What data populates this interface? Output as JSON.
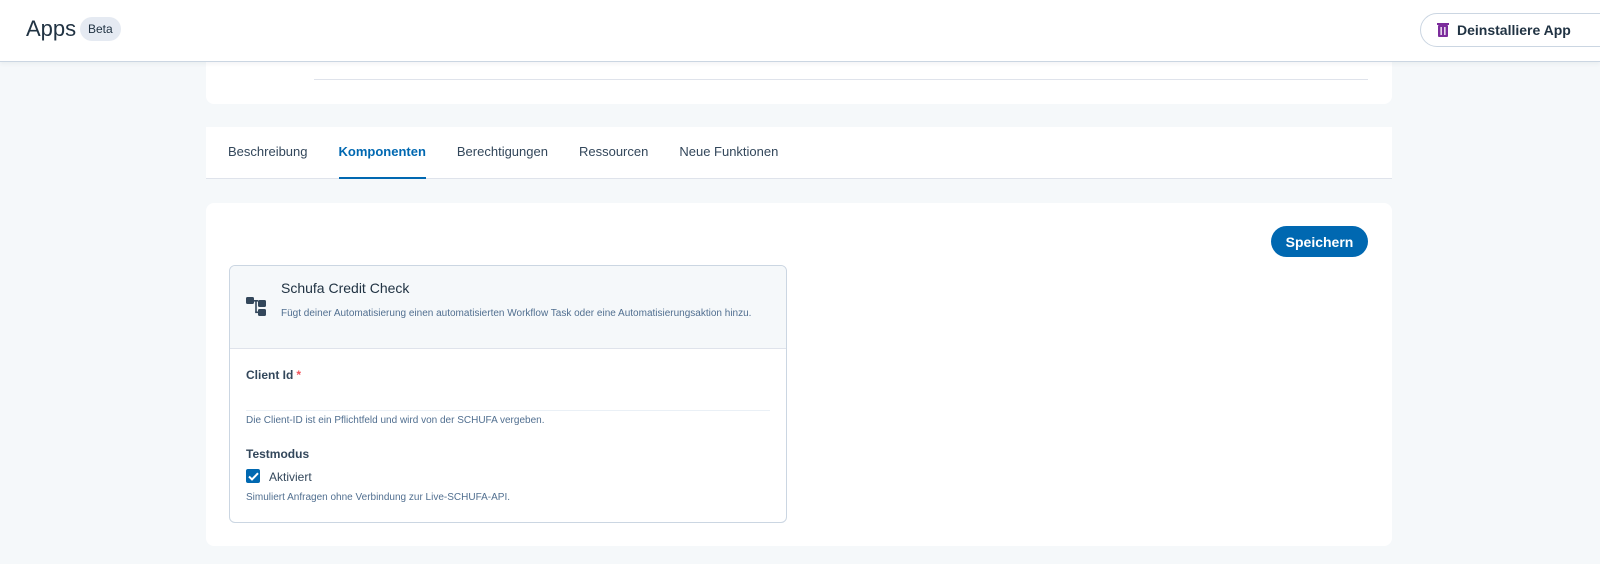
{
  "header": {
    "title": "Apps",
    "badge": "Beta",
    "uninstall_label": "Deinstalliere App"
  },
  "tabs": [
    {
      "label": "Beschreibung",
      "active": false
    },
    {
      "label": "Komponenten",
      "active": true
    },
    {
      "label": "Berechtigungen",
      "active": false
    },
    {
      "label": "Ressourcen",
      "active": false
    },
    {
      "label": "Neue Funktionen",
      "active": false
    }
  ],
  "actions": {
    "save_label": "Speichern"
  },
  "component": {
    "icon": "workflow-icon",
    "title": "Schufa Credit Check",
    "description": "Fügt deiner Automatisierung einen automatisierten Workflow Task oder eine Automatisierungsaktion hinzu.",
    "client_id": {
      "label": "Client Id",
      "required_marker": "*",
      "value": "",
      "help": "Die Client-ID ist ein Pflichtfeld und wird von der SCHUFA vergeben."
    },
    "test_mode": {
      "label": "Testmodus",
      "checkbox_label": "Aktiviert",
      "checked": true,
      "help": "Simuliert Anfragen ohne Verbindung zur Live-SCHUFA-API."
    }
  },
  "colors": {
    "accent": "#0068b1",
    "required": "#f2545b",
    "trash": "#7c2d9c"
  }
}
